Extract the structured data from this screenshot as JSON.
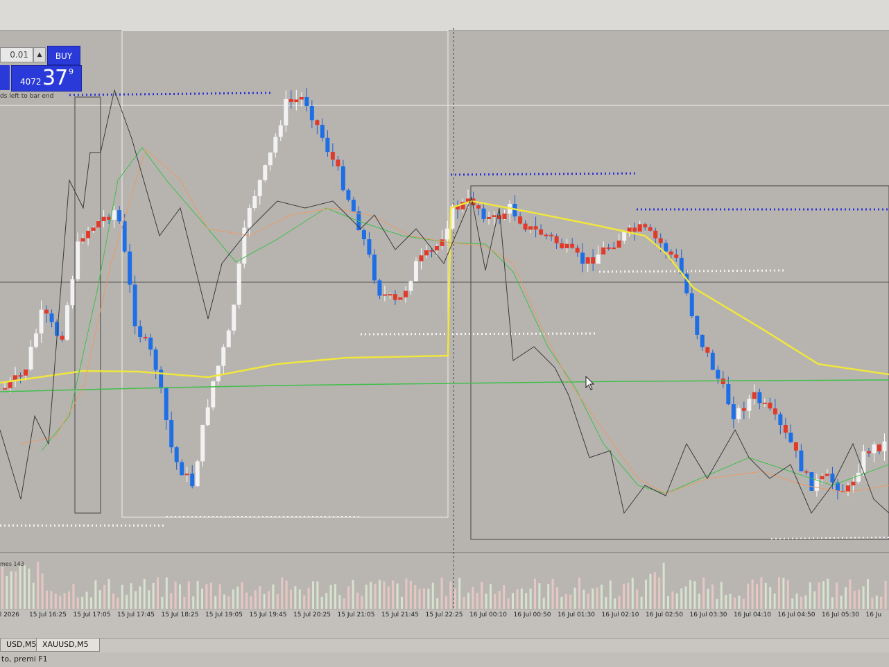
{
  "trade_panel": {
    "lot_value": "0.01",
    "buy_label": "BUY",
    "price_small": "4072",
    "price_big": "37",
    "price_sup": "9",
    "bar_end_text": "ds left to bar end"
  },
  "volume_label": "mes 143",
  "time_axis": [
    "ul 2026",
    "15 Jul 16:25",
    "15 Jul 17:05",
    "15 Jul 17:45",
    "15 Jul 18:25",
    "15 Jul 19:05",
    "15 Jul 19:45",
    "15 Jul 20:25",
    "15 Jul 21:05",
    "15 Jul 21:45",
    "15 Jul 22:25",
    "16 Jul 00:10",
    "16 Jul 00:50",
    "16 Jul 01:30",
    "16 Jul 02:10",
    "16 Jul 02:50",
    "16 Jul 03:30",
    "16 Jul 04:10",
    "16 Jul 04:50",
    "16 Jul 05:30",
    "16 Ju"
  ],
  "tabs": [
    "USD,M5",
    "XAUUSD,M5"
  ],
  "status_text": "to, premi F1",
  "colors": {
    "bull": "#f2f2f2",
    "bear": "#1e6fe6",
    "red_candle": "#e03a2a",
    "ma_yellow": "#f0e63c",
    "ma_green": "#3fbf4a",
    "ma_orange": "#e89a66",
    "line_black": "#3a3a3a",
    "dot_blue": "#2b2fd6",
    "dot_white": "#f4f4f4",
    "buy_blue": "#2a3ad8"
  },
  "chart_data": {
    "type": "candlestick",
    "symbol": "XAUUSD",
    "timeframe": "M5",
    "notes": "",
    "close_path": [
      560,
      540,
      450,
      490,
      340,
      320,
      300,
      470,
      520,
      660,
      700,
      560,
      480,
      300,
      240,
      150,
      140,
      200,
      260,
      330,
      420,
      440,
      380,
      360,
      300,
      290,
      320,
      300,
      330,
      340,
      360,
      380,
      360,
      340,
      330,
      350,
      380,
      480,
      540,
      600,
      570,
      600,
      640,
      700,
      690,
      710,
      650,
      640
    ]
  }
}
